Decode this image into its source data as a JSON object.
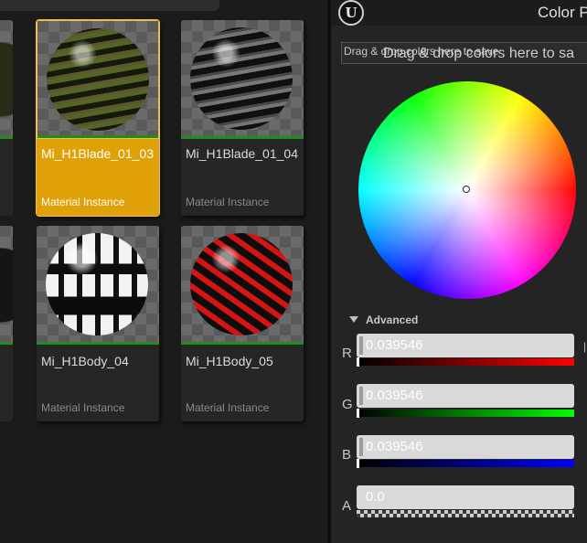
{
  "browser": {
    "tiles": [
      {
        "title": "Mi_H1Blade_01_03",
        "type": "Material Instance",
        "selected": true
      },
      {
        "title": "Mi_H1Blade_01_04",
        "type": "Material Instance",
        "selected": false
      },
      {
        "title": "Mi_H1Body_04",
        "type": "Material Instance",
        "selected": false
      },
      {
        "title": "Mi_H1Body_05",
        "type": "Material Instance",
        "selected": false
      }
    ]
  },
  "picker": {
    "title": "Color P",
    "logo": "U",
    "swatch_drop_small": "Drag & drop colors here to save",
    "swatch_drop_big": "Drag & drop colors here to sa",
    "advanced_label": "Advanced",
    "channels": [
      {
        "label": "R",
        "value": "0.039546"
      },
      {
        "label": "G",
        "value": "0.039546"
      },
      {
        "label": "B",
        "value": "0.039546"
      },
      {
        "label": "A",
        "value": "0.0"
      }
    ]
  },
  "colors": {
    "selected_tile": "#e0a008",
    "accent_green": "#1e8f1e"
  }
}
